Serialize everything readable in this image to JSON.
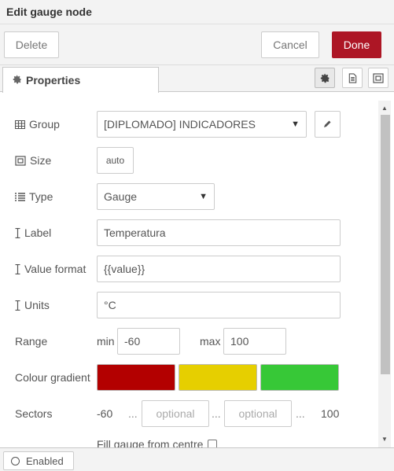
{
  "dialog": {
    "title": "Edit gauge node"
  },
  "buttons": {
    "delete": "Delete",
    "cancel": "Cancel",
    "done": "Done"
  },
  "tabs": {
    "properties": "Properties",
    "icons": [
      "gear-icon",
      "description-icon",
      "appearance-icon"
    ]
  },
  "form": {
    "group": {
      "label": "Group",
      "value": "[DIPLOMADO] INDICADORES",
      "icon": "table-icon"
    },
    "size": {
      "label": "Size",
      "value": "auto",
      "icon": "resize-icon"
    },
    "type": {
      "label": "Type",
      "value": "Gauge",
      "icon": "list-icon"
    },
    "label": {
      "label": "Label",
      "value": "Temperatura",
      "icon": "text-cursor-icon"
    },
    "value_format": {
      "label": "Value format",
      "value": "{{value}}",
      "icon": "text-cursor-icon"
    },
    "units": {
      "label": "Units",
      "value": "°C",
      "icon": "text-cursor-icon"
    },
    "range": {
      "label": "Range",
      "min_label": "min",
      "min_value": "-60",
      "max_label": "max",
      "max_value": "100"
    },
    "colour_gradient": {
      "label": "Colour gradient",
      "colors": [
        "#b30000",
        "#e6cf00",
        "#37c837"
      ]
    },
    "sectors": {
      "label": "Sectors",
      "start": "-60",
      "sep1": "...",
      "sep2": "...",
      "sep3": "...",
      "placeholder1": "optional",
      "placeholder2": "optional",
      "end": "100"
    },
    "fill_from_centre": {
      "label": "Fill gauge from centre",
      "checked": false
    }
  },
  "footer": {
    "enabled_label": "Enabled"
  }
}
